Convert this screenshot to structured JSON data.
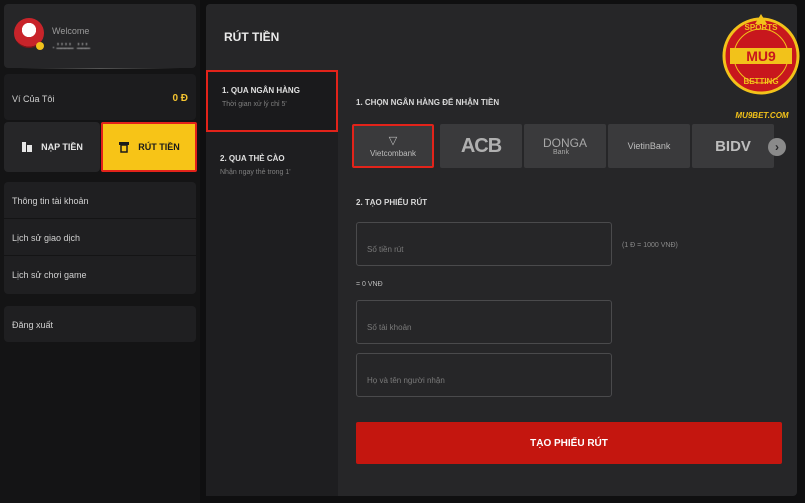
{
  "profile": {
    "welcome": "Welcome",
    "username": "·ʼ̶ʼ̶ʼ̶ʼ̶ ʼ̶ʼ̶ʼ̶"
  },
  "wallet": {
    "label": "Ví Của Tôi",
    "amount": "0 Đ"
  },
  "actions": {
    "deposit": "NẠP TIỀN",
    "withdraw": "RÚT TIỀN"
  },
  "menu": {
    "items": [
      {
        "label": "Thông tin tài khoản"
      },
      {
        "label": "Lịch sử giao dịch"
      },
      {
        "label": "Lịch sử chơi game"
      }
    ],
    "logout": "Đăng xuất"
  },
  "main": {
    "title": "RÚT TIỀN",
    "methods": [
      {
        "title": "1. QUA NGÂN HÀNG",
        "sub": "Thời gian xử lý chỉ 5'"
      },
      {
        "title": "2. QUA THẺ CÀO",
        "sub": "Nhận ngay thẻ trong 1'"
      }
    ],
    "step1": "1. CHỌN NGÂN HÀNG ĐỂ NHẬN TIỀN",
    "banks": {
      "vcb_logo": "▽",
      "vcb": "Vietcombank",
      "acb": "ACB",
      "donga": "DONGA",
      "donga_sub": "Bank",
      "vietin": "VietinBank",
      "bidv": "BIDV"
    },
    "next_icon": "›",
    "step2": "2. TẠO PHIẾU RÚT",
    "amount_placeholder": "Số tiền rút",
    "rate_note": "(1 Đ = 1000 VNĐ)",
    "converted": "= 0 VNĐ",
    "account_placeholder": "Số tài khoản",
    "name_placeholder": "Họ và tên người nhận",
    "submit": "TẠO PHIẾU RÚT"
  },
  "watermark": {
    "text_top": "SPORTS",
    "text_mid": "MU9",
    "text_bottom": "BETTING",
    "url": "MU9BET.COM"
  },
  "colors": {
    "accent_red": "#e2231a",
    "accent_yellow": "#f7c417",
    "submit_red": "#c4160f"
  }
}
